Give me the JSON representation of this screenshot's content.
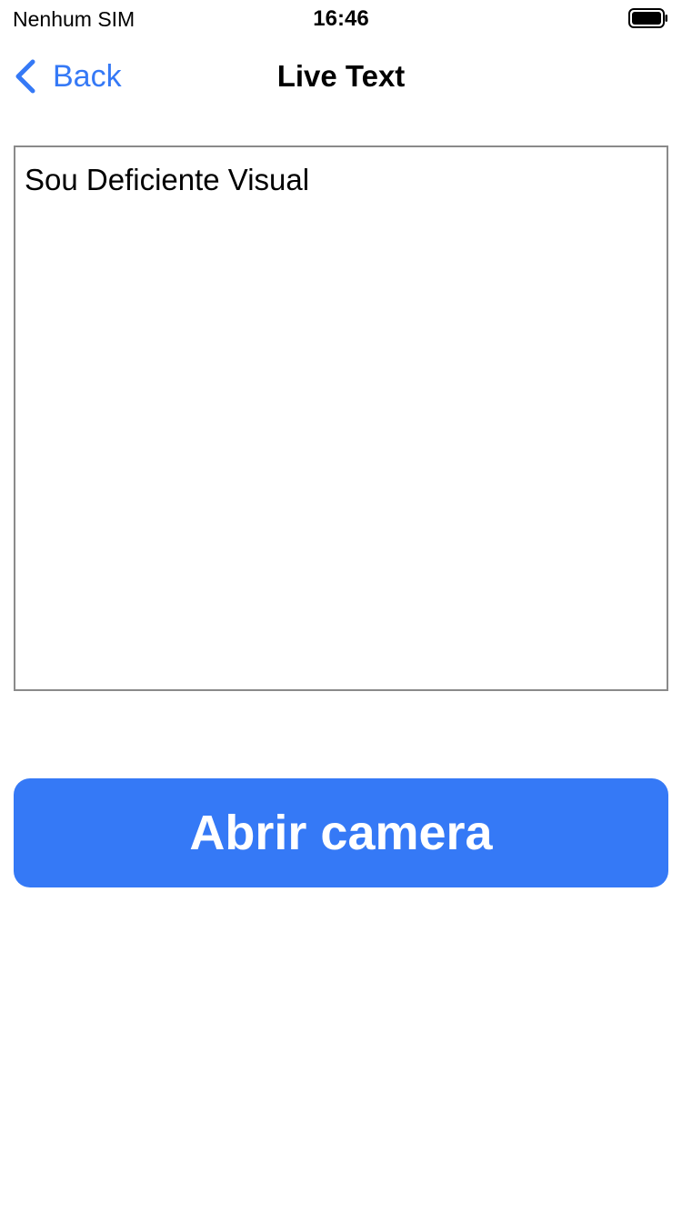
{
  "status_bar": {
    "carrier": "Nenhum SIM",
    "time": "16:46",
    "battery_icon": "battery-full-icon"
  },
  "nav": {
    "back_icon": "chevron-left-icon",
    "back_label": "Back",
    "title": "Live Text"
  },
  "text_view": {
    "content": "Sou Deficiente Visual"
  },
  "primary_button": {
    "label": "Abrir camera"
  },
  "colors": {
    "accent": "#3579f6",
    "border": "#8a8a8a",
    "background": "#ffffff"
  }
}
